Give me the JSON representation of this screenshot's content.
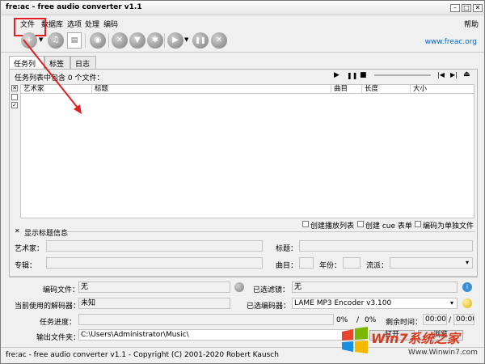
{
  "window": {
    "title": "fre:ac - free audio converter v1.1"
  },
  "titlebar_buttons": {
    "minimize": "–",
    "maximize": "□",
    "close": "✕"
  },
  "menu": {
    "file": "文件",
    "library": "数据库",
    "options": "选项",
    "process": "处理",
    "encode": "编码",
    "help": "帮助"
  },
  "toolbar": {
    "add_glyph": "+",
    "play_glyph": "▶",
    "stop_glyph": "✕",
    "pause_glyph": "❚❚",
    "link": "www.freac.org"
  },
  "tabs": [
    "任务列表",
    "标签",
    "日志"
  ],
  "joblist": {
    "count_text": "任务列表中包含 0 个文件：",
    "columns": [
      "艺术家",
      "标题",
      "曲目",
      "长度",
      "大小"
    ]
  },
  "player": {
    "play": "▶",
    "pause": "❚❚",
    "stop": "■",
    "prev": "|◀",
    "next": "▶|",
    "eject": "⏏"
  },
  "options": {
    "playlist": "创建播放列表",
    "cuesheet": "创建 cue 表单",
    "separate": "编码为单独文件",
    "show_title_info": "显示标题信息"
  },
  "titleinfo": {
    "artist_label": "艺术家：",
    "title_label": "标题：",
    "album_label": "专辑：",
    "track_label": "曲目：",
    "year_label": "年份：",
    "genre_label": "流派："
  },
  "encoding": {
    "encode_file_label": "编码文件：",
    "encode_file_value": "无",
    "selected_filter_label": "已选滤镜：",
    "selected_filter_value": "无",
    "decoder_label": "当前使用的解码器：",
    "decoder_value": "未知",
    "encoder_label": "已选编码器：",
    "encoder_value": "LAME MP3 Encoder v3.100",
    "progress_label": "任务进度：",
    "progress_pct": "0%",
    "progress_sep": "/",
    "total_pct": "0%",
    "remaining_label": "剩余时间：",
    "remaining_value": "00:00",
    "total_time_value": "00:00",
    "output_label": "输出文件夹：",
    "output_value": "C:\\Users\\Administrator\\Music\\",
    "open_button": "打开",
    "browse_button": "浏览"
  },
  "statusbar": {
    "text": "fre:ac - free audio converter v1.1 - Copyright (C) 2001-2020 Robert Kausch"
  },
  "watermark": {
    "text": "Win7系统之家",
    "url": "Www.Winwin7.com"
  },
  "accent_colors": {
    "highlight": "#e02020",
    "link": "#0066cc"
  }
}
